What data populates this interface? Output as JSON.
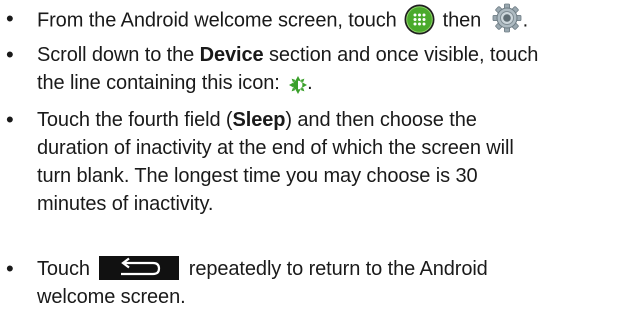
{
  "steps": [
    {
      "prefix": "From the Android welcome screen, touch ",
      "middle": " then ",
      "suffix": ".",
      "icons": [
        "apps-grid-icon",
        "settings-gear-icon"
      ]
    },
    {
      "text_a": "Scroll down to the ",
      "bold_a": "Device",
      "text_b": " section and once visible, touch",
      "text_c": "the line containing this icon: ",
      "suffix": ".",
      "icons": [
        "brightness-icon"
      ]
    },
    {
      "text_a": "Touch the fourth field (",
      "bold_a": "Sleep",
      "text_b": ") and then choose the",
      "line2": "duration of inactivity at the end of which the screen will",
      "line3": "turn blank. The longest time you may choose is 30",
      "line4": "minutes of inactivity."
    },
    {
      "prefix": "Touch ",
      "suffix": " repeatedly to return to the Android",
      "line2": "welcome screen.",
      "icons": [
        "back-arrow-icon"
      ]
    }
  ],
  "colors": {
    "text": "#1a1a1a",
    "apps_icon_green": "#4aaa2b",
    "brightness_icon_green": "#3aa02a",
    "back_button_bg": "#111111"
  }
}
